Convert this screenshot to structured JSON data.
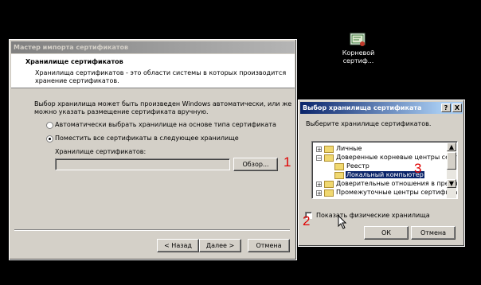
{
  "desktop": {
    "icon_label_line1": "Корневой",
    "icon_label_line2": "сертиф..."
  },
  "wizard": {
    "title": "Мастер импорта сертификатов",
    "header_title": "Хранилище сертификатов",
    "header_desc_line1": "Хранилища сертификатов - это области системы в которых производится",
    "header_desc_line2": "хранение сертификатов.",
    "body_line1": "Выбор хранилища может быть произведен Windows автоматически, или же",
    "body_line2": "можно указать размещение сертификата вручную.",
    "radio_auto": "Автоматически выбрать хранилище на основе типа сертификата",
    "radio_manual": "Поместить все сертификаты в следующее хранилище",
    "store_label": "Хранилище сертификатов:",
    "store_value": "",
    "browse_button": "Обзор...",
    "back_button": "< Назад",
    "next_button": "Далее >",
    "cancel_button": "Отмена"
  },
  "selector": {
    "title": "Выбор хранилища сертификата",
    "help_button": "?",
    "close_button": "X",
    "prompt": "Выберите хранилище сертификатов.",
    "tree": {
      "item1": "Личные",
      "item2": "Доверенные корневые центры сертиф",
      "item2a": "Реестр",
      "item2b": "Локальный компьютер",
      "item3": "Доверительные отношения в предпри",
      "item4": "Промежуточные центры сертификации"
    },
    "checkbox_label": "Показать физические хранилища",
    "ok_button": "ОК",
    "cancel_button": "Отмена"
  },
  "annotations": {
    "a1": "1",
    "a2": "2",
    "a3": "3"
  },
  "colors": {
    "annotation": "#e00000",
    "selection": "#0a246a"
  }
}
